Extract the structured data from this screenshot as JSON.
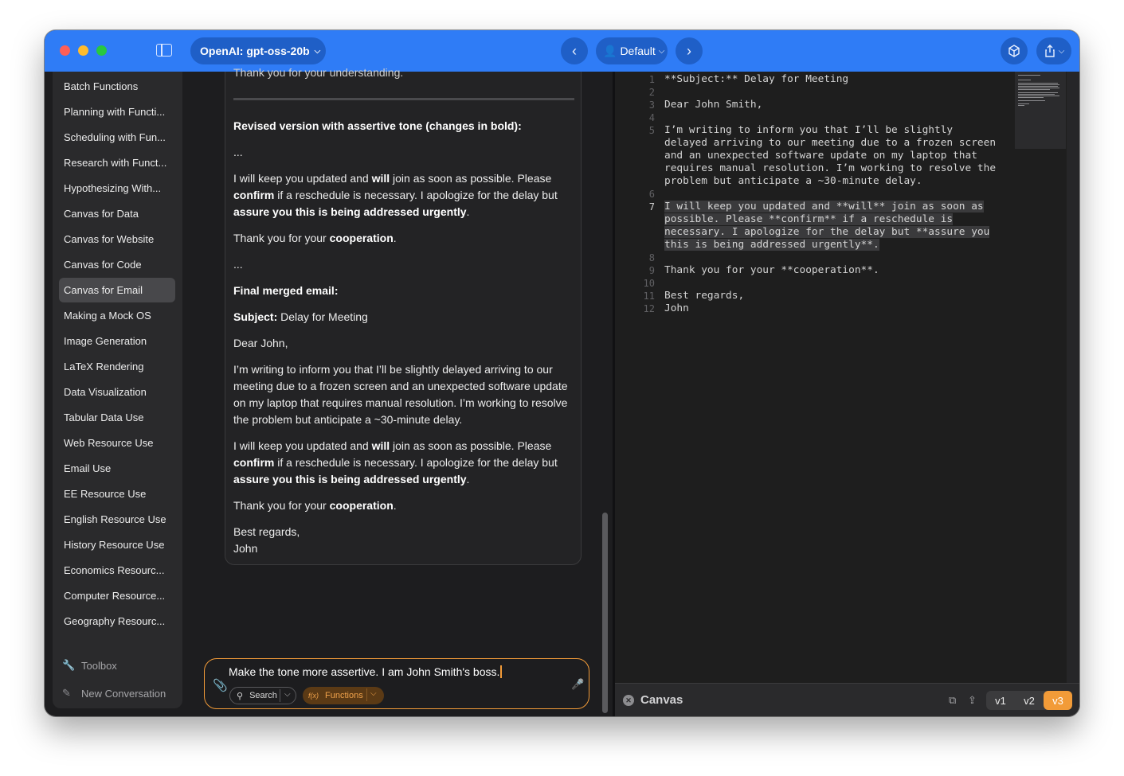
{
  "titlebar": {
    "model": "OpenAI: gpt-oss-20b",
    "profile": "Default"
  },
  "sidebar": {
    "items": [
      {
        "label": "Batch Functions",
        "active": false
      },
      {
        "label": "Planning with Functi...",
        "active": false
      },
      {
        "label": "Scheduling with Fun...",
        "active": false
      },
      {
        "label": "Research with Funct...",
        "active": false
      },
      {
        "label": "Hypothesizing With...",
        "active": false
      },
      {
        "label": "Canvas for Data",
        "active": false
      },
      {
        "label": "Canvas for Website",
        "active": false
      },
      {
        "label": "Canvas for Code",
        "active": false
      },
      {
        "label": "Canvas for Email",
        "active": true
      },
      {
        "label": "Making a Mock OS",
        "active": false
      },
      {
        "label": "Image Generation",
        "active": false
      },
      {
        "label": "LaTeX Rendering",
        "active": false
      },
      {
        "label": "Data Visualization",
        "active": false
      },
      {
        "label": "Tabular Data Use",
        "active": false
      },
      {
        "label": "Web Resource Use",
        "active": false
      },
      {
        "label": "Email Use",
        "active": false
      },
      {
        "label": "EE Resource Use",
        "active": false
      },
      {
        "label": "English Resource Use",
        "active": false
      },
      {
        "label": "History Resource Use",
        "active": false
      },
      {
        "label": "Economics Resourc...",
        "active": false
      },
      {
        "label": "Computer Resource...",
        "active": false
      },
      {
        "label": "Geography Resourc...",
        "active": false
      }
    ],
    "toolbox": "Toolbox",
    "new_conversation": "New Conversation"
  },
  "message": {
    "top_cut": "Thank you for your understanding.",
    "revised_heading": "Revised version with assertive tone (changes in bold):",
    "ellipsis": "...",
    "p1_a": "I will keep you updated and ",
    "p1_b": "will",
    "p1_c": " join as soon as possible. Please ",
    "p1_d": "confirm",
    "p1_e": " if a reschedule is necessary. I apologize for the delay but ",
    "p1_f": "assure you this is being addressed urgently",
    "p1_g": ".",
    "thanks_a": "Thank you for your ",
    "thanks_b": "cooperation",
    "thanks_c": ".",
    "final_heading": "Final merged email:",
    "subject_label": "Subject:",
    "subject_value": " Delay for Meeting",
    "greeting": "Dear John,",
    "body": "I’m writing to inform you that I’ll be slightly delayed arriving to our meeting due to a frozen screen and an unexpected software update on my laptop that requires manual resolution. I’m working to resolve the problem but anticipate a ~30-minute delay.",
    "closing": "Best regards,",
    "signature": "John"
  },
  "input": {
    "text": "Make the tone more assertive. I am John Smith's boss.",
    "search_label": "Search",
    "functions_label": "Functions"
  },
  "editor": {
    "lines": [
      {
        "num": "1",
        "text": "**Subject:** Delay for Meeting"
      },
      {
        "num": "2",
        "text": ""
      },
      {
        "num": "3",
        "text": "Dear John Smith,"
      },
      {
        "num": "4",
        "text": ""
      },
      {
        "num": "5",
        "text": "I’m writing to inform you that I’ll be slightly"
      },
      {
        "num": "",
        "text": "delayed arriving to our meeting due to a frozen screen"
      },
      {
        "num": "",
        "text": "and an unexpected software update on my laptop that"
      },
      {
        "num": "",
        "text": "requires manual resolution. I’m working to resolve the"
      },
      {
        "num": "",
        "text": "problem but anticipate a ~30-minute delay."
      },
      {
        "num": "6",
        "text": ""
      },
      {
        "num": "7",
        "text": "I will keep you updated and **will** join as soon as"
      },
      {
        "num": "",
        "text": "possible. Please **confirm** if a reschedule is"
      },
      {
        "num": "",
        "text": "necessary. I apologize for the delay but **assure you"
      },
      {
        "num": "",
        "text": "this is being addressed urgently**."
      },
      {
        "num": "8",
        "text": ""
      },
      {
        "num": "9",
        "text": "Thank you for your **cooperation**."
      },
      {
        "num": "10",
        "text": ""
      },
      {
        "num": "11",
        "text": "Best regards,"
      },
      {
        "num": "12",
        "text": "John"
      }
    ],
    "active_line": "7"
  },
  "canvas": {
    "title": "Canvas",
    "versions": [
      "v1",
      "v2",
      "v3"
    ],
    "active_version": "v3"
  },
  "colors": {
    "titlebar": "#2f7cf6",
    "accent": "#f29b38"
  }
}
